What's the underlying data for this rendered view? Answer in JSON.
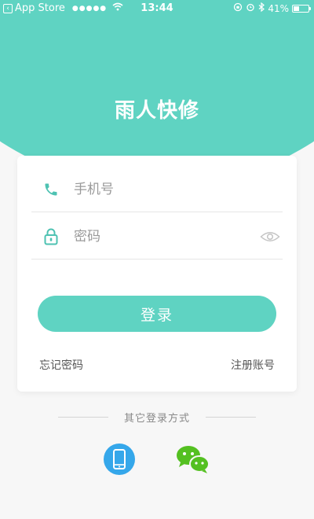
{
  "status_bar": {
    "back_app": "App Store",
    "signal": "●●●●●",
    "time": "13:44",
    "battery_percent": "41%",
    "battery_level": 0.41
  },
  "app": {
    "title": "雨人快修"
  },
  "login_form": {
    "phone_placeholder": "手机号",
    "phone_value": "",
    "password_placeholder": "密码",
    "password_value": "",
    "login_label": "登录",
    "forgot_label": "忘记密码",
    "register_label": "注册账号"
  },
  "other_login": {
    "label": "其它登录方式",
    "methods": [
      "phone-icon",
      "wechat-icon"
    ]
  },
  "colors": {
    "accent": "#5fd3c2",
    "icon_teal": "#4ec2b2",
    "phone_blue": "#35a7ea",
    "wechat_green": "#54c021"
  }
}
